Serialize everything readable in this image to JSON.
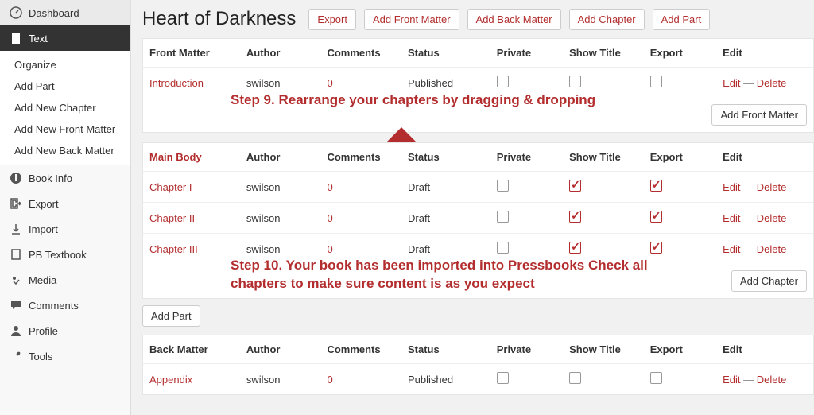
{
  "sidebar": {
    "dashboard": "Dashboard",
    "text": "Text",
    "text_subs": [
      "Organize",
      "Add Part",
      "Add New Chapter",
      "Add New Front Matter",
      "Add New Back Matter"
    ],
    "book_info": "Book Info",
    "export": "Export",
    "import": "Import",
    "pb_textbook": "PB Textbook",
    "media": "Media",
    "comments": "Comments",
    "profile": "Profile",
    "tools": "Tools"
  },
  "page": {
    "title": "Heart of Darkness",
    "buttons": {
      "export": "Export",
      "add_front": "Add Front Matter",
      "add_back": "Add Back Matter",
      "add_chapter": "Add Chapter",
      "add_part": "Add Part"
    }
  },
  "columns": {
    "author": "Author",
    "comments": "Comments",
    "status": "Status",
    "private": "Private",
    "show_title": "Show Title",
    "export": "Export",
    "edit": "Edit"
  },
  "actions": {
    "edit": "Edit",
    "delete": "Delete",
    "sep": " — ",
    "add_front_matter": "Add Front Matter",
    "add_chapter": "Add Chapter",
    "add_part": "Add Part"
  },
  "front": {
    "heading": "Front Matter",
    "rows": [
      {
        "title": "Introduction",
        "author": "swilson",
        "comments": "0",
        "status": "Published",
        "private": false,
        "show_title": false,
        "export": false
      }
    ]
  },
  "main_body": {
    "heading": "Main Body",
    "rows": [
      {
        "title": "Chapter I",
        "author": "swilson",
        "comments": "0",
        "status": "Draft",
        "private": false,
        "show_title": true,
        "export": true
      },
      {
        "title": "Chapter II",
        "author": "swilson",
        "comments": "0",
        "status": "Draft",
        "private": false,
        "show_title": true,
        "export": true
      },
      {
        "title": "Chapter III",
        "author": "swilson",
        "comments": "0",
        "status": "Draft",
        "private": false,
        "show_title": true,
        "export": true
      }
    ]
  },
  "back": {
    "heading": "Back Matter",
    "rows": [
      {
        "title": "Appendix",
        "author": "swilson",
        "comments": "0",
        "status": "Published",
        "private": false,
        "show_title": false,
        "export": false
      }
    ]
  },
  "annotations": {
    "step9": "Step 9.  Rearrange your chapters by dragging & dropping",
    "step10": "Step 10. Your book has been imported into Pressbooks Check all chapters to make sure content is as you expect"
  }
}
